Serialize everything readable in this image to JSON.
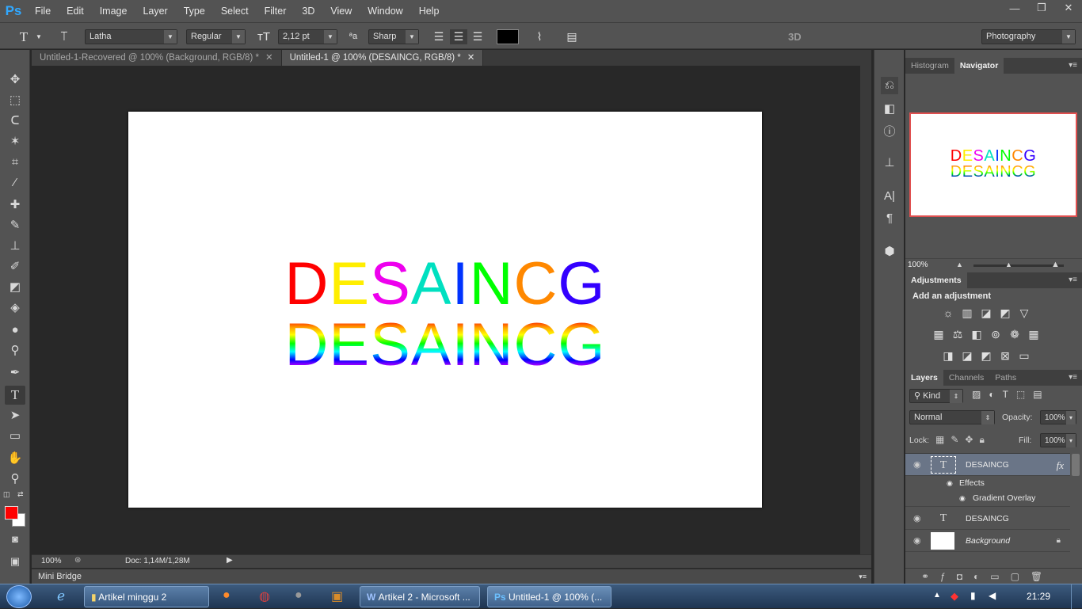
{
  "app": {
    "logo": "Ps",
    "window_controls": [
      "—",
      "❐",
      "✕"
    ]
  },
  "menu": [
    "File",
    "Edit",
    "Image",
    "Layer",
    "Type",
    "Select",
    "Filter",
    "3D",
    "View",
    "Window",
    "Help"
  ],
  "options": {
    "font_family": "Latha",
    "font_style": "Regular",
    "font_size": "2,12 pt",
    "antialias": "Sharp",
    "mode_3d": "3D",
    "workspace": "Photography",
    "text_color": "#000000"
  },
  "tabs": [
    {
      "label": "Untitled-1-Recovered @ 100% (Background, RGB/8) *",
      "close": "✕"
    },
    {
      "label": "Untitled-1 @ 100% (DESAINCG, RGB/8) *",
      "close": "✕"
    }
  ],
  "canvas": {
    "word": "DESAINCG",
    "letters": [
      "D",
      "E",
      "S",
      "A",
      "I",
      "N",
      "C",
      "G"
    ],
    "letter_colors": [
      "#ff0000",
      "#ffee00",
      "#ee00ee",
      "#00e0c0",
      "#0033ff",
      "#00ff00",
      "#ff8800",
      "#3300ff"
    ]
  },
  "status": {
    "zoom": "100%",
    "doc": "Doc: 1,14M/1,28M"
  },
  "mini_bridge": "Mini Bridge",
  "navigator": {
    "tabs": [
      "Histogram",
      "Navigator"
    ],
    "zoom": "100%"
  },
  "adjustments": {
    "tab": "Adjustments",
    "heading": "Add an adjustment"
  },
  "layers_panel": {
    "tabs": [
      "Layers",
      "Channels",
      "Paths"
    ],
    "kind": "Kind",
    "blend_mode": "Normal",
    "opacity_label": "Opacity:",
    "opacity": "100%",
    "lock_label": "Lock:",
    "fill_label": "Fill:",
    "fill": "100%",
    "layers": [
      {
        "name": "DESAINCG",
        "fx": "fx",
        "effects_label": "Effects",
        "effect": "Gradient Overlay"
      },
      {
        "name": "DESAINCG"
      },
      {
        "name": "Background"
      }
    ]
  },
  "taskbar": {
    "items": [
      "Artikel minggu 2",
      "Artikel 2 - Microsoft ...",
      "Untitled-1 @ 100% (..."
    ],
    "time": "21:29"
  }
}
